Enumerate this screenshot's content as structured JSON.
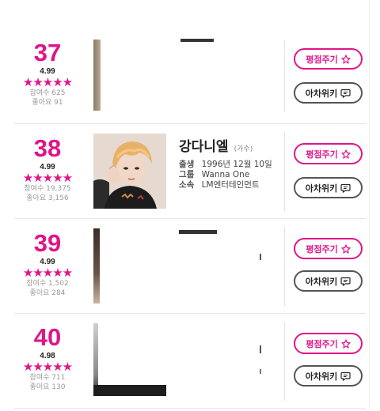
{
  "rating_button": {
    "label": "평점주기",
    "icon": "star-outline-icon",
    "color": "#e0158a"
  },
  "wiki_button": {
    "label": "아차위키",
    "icon": "speech-bubble-icon"
  },
  "detail_keys": {
    "birth": "출생",
    "group": "그룹",
    "agency": "소속"
  },
  "rows": [
    {
      "rank": "37",
      "score": "4.99",
      "stars": "★★★★★",
      "participants": "참여수 625",
      "likes": "좋아요 91"
    },
    {
      "rank": "38",
      "score": "4.99",
      "stars": "★★★★★",
      "participants": "참여수 19,375",
      "likes": "좋아요 3,156",
      "name": "강다니엘",
      "job": "(가수)",
      "birth": "1996년 12월 10일",
      "group": "Wanna One",
      "agency": "LM엔터테인먼트"
    },
    {
      "rank": "39",
      "score": "4.99",
      "stars": "★★★★★",
      "participants": "참여수 1,502",
      "likes": "좋아요 284"
    },
    {
      "rank": "40",
      "score": "4.98",
      "stars": "★★★★★",
      "participants": "참여수 711",
      "likes": "좋아요 130"
    }
  ]
}
